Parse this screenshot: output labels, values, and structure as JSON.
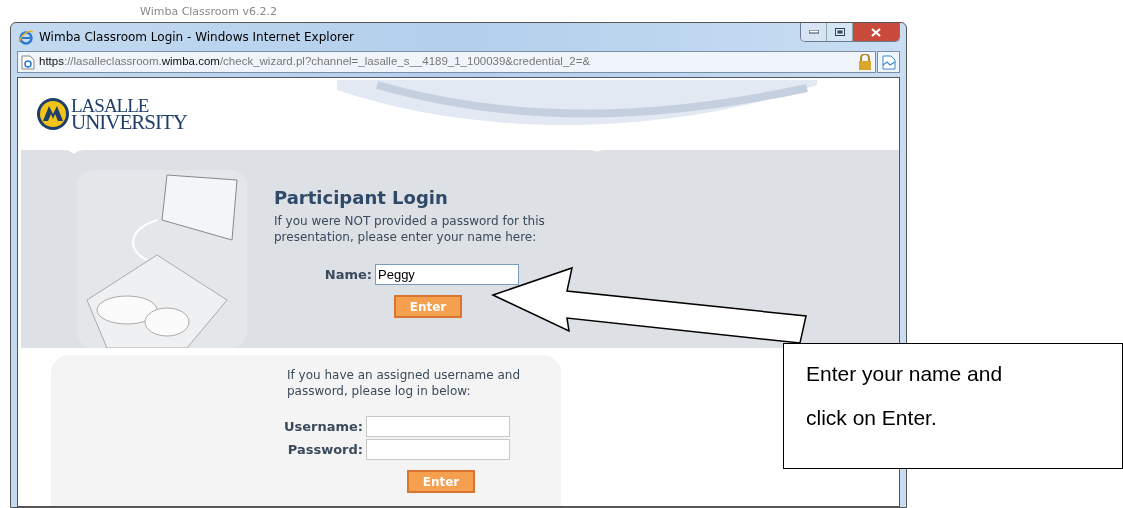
{
  "desktop_text": "Wimba Classroom v6.2.2",
  "window": {
    "title": "Wimba Classroom Login - Windows Internet Explorer",
    "address": [
      {
        "text": "https",
        "strong": true
      },
      {
        "text": "://lasalleclassroom.",
        "strong": false
      },
      {
        "text": "wimba.com",
        "strong": true
      },
      {
        "text": "/check_wizard.pl?channel=_lasalle_s__4189_1_100039&credential_2=&",
        "strong": false
      }
    ]
  },
  "logo": [
    "LASALLE",
    "UNIVERSITY"
  ],
  "participant": {
    "heading": "Participant Login",
    "text": "If you were NOT provided a password for this presentation, please enter your name here:",
    "name_label": "Name:",
    "name_value": "Peggy",
    "button": "Enter"
  },
  "account": {
    "text": "If you have an assigned username and password, please log in below:",
    "fields": [
      {
        "label": "Username:"
      },
      {
        "label": "Password:"
      }
    ],
    "button": "Enter"
  },
  "callout": "Enter your name and click on Enter."
}
